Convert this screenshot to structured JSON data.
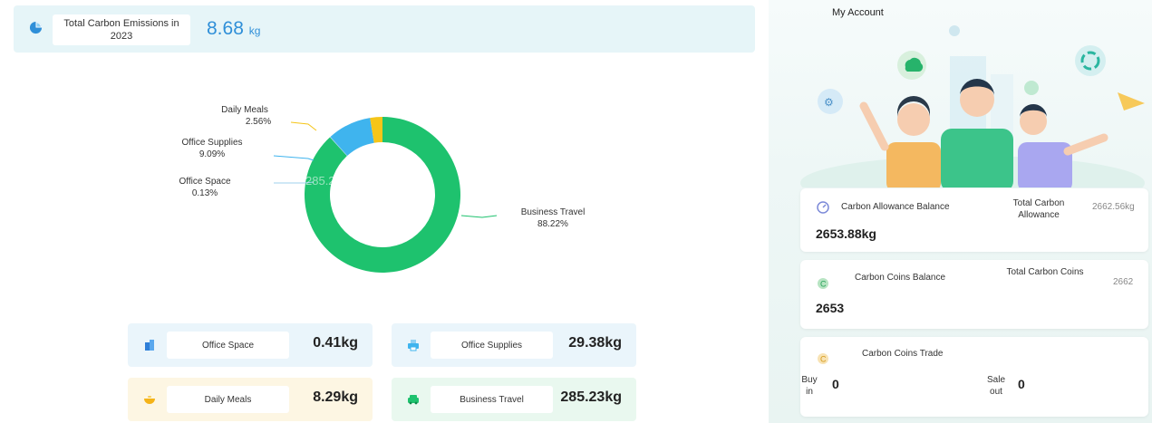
{
  "header": {
    "title": "Total Carbon Emissions in 2023",
    "total_value": "8.68",
    "total_unit": "kg"
  },
  "chart_data": {
    "type": "pie",
    "slices": [
      {
        "label": "Business Travel",
        "percent": 88.22,
        "color": "#1ec26e"
      },
      {
        "label": "Office Space",
        "percent": 0.13,
        "color": "#9fd0ee"
      },
      {
        "label": "Office Supplies",
        "percent": 9.09,
        "color": "#3fb4ee"
      },
      {
        "label": "Daily Meals",
        "percent": 2.56,
        "color": "#f5c518"
      }
    ],
    "labels": {
      "daily_meals": "Daily Meals",
      "daily_meals_pct": "2.56%",
      "office_supplies": "Office Supplies",
      "office_supplies_pct": "9.09%",
      "office_space": "Office Space",
      "office_space_pct": "0.13%",
      "business_travel": "Business Travel",
      "business_travel_pct": "88.22%"
    },
    "center_text": "285.23 (88.22%)"
  },
  "categories": [
    {
      "label": "Office Space",
      "value": "0.41kg",
      "bg": "#eaf5fb",
      "icon": "building-icon",
      "color": "#2f7fd8"
    },
    {
      "label": "Office Supplies",
      "value": "29.38kg",
      "bg": "#eaf5fb",
      "icon": "printer-icon",
      "color": "#3fb4ee"
    },
    {
      "label": "Daily Meals",
      "value": "8.29kg",
      "bg": "#fdf6e3",
      "icon": "bowl-icon",
      "color": "#f5b318"
    },
    {
      "label": "Business Travel",
      "value": "285.23kg",
      "bg": "#e9f8ef",
      "icon": "car-icon",
      "color": "#1ec26e"
    }
  ],
  "account": {
    "title": "My Account",
    "allowance": {
      "label": "Carbon Allowance Balance",
      "value": "2653.88kg",
      "total_label": "Total Carbon Allowance",
      "total_value": "2662.56kg"
    },
    "coins": {
      "label": "Carbon Coins Balance",
      "value": "2653",
      "total_label": "Total Carbon Coins",
      "total_value": "2662"
    },
    "trade": {
      "label": "Carbon Coins Trade",
      "buy_label": "Buy in",
      "buy_value": "0",
      "sale_label": "Sale out",
      "sale_value": "0"
    }
  }
}
